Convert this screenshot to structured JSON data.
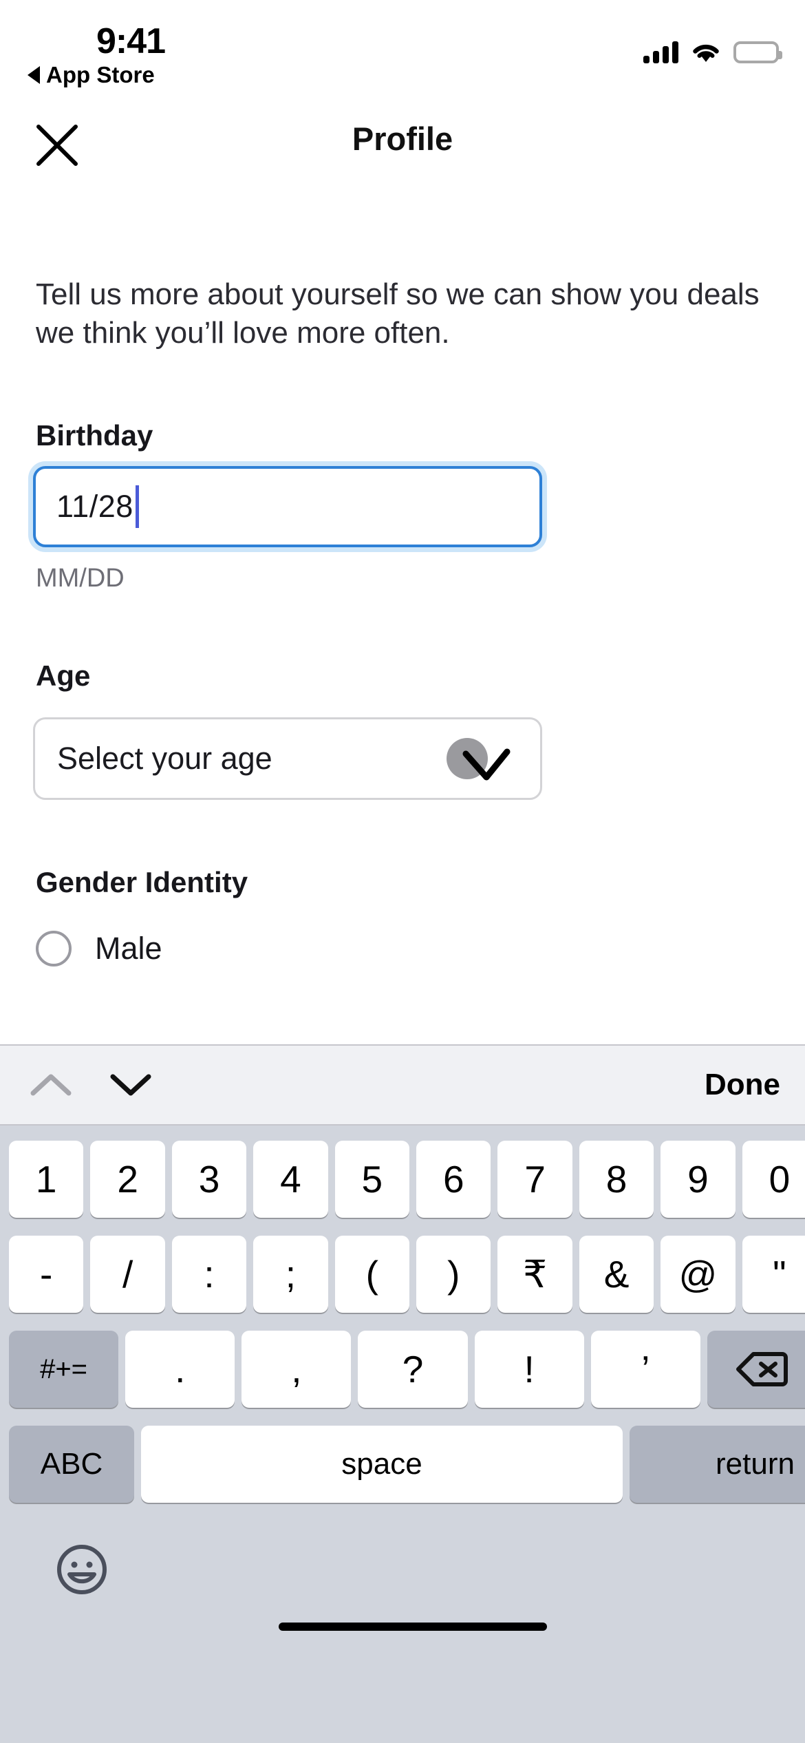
{
  "status_bar": {
    "time": "9:41",
    "back_label": "App Store",
    "back_icon": "triangle-left-icon",
    "signal_icon": "cellular-signal-icon",
    "signal_bars": 4,
    "wifi_icon": "wifi-icon",
    "battery_icon": "battery-full-icon"
  },
  "nav": {
    "close_icon": "close-x-icon",
    "title": "Profile"
  },
  "main": {
    "intro": "Tell us more about yourself so we can show you deals\nwe think you’ll love more often.",
    "birthday": {
      "label": "Birthday",
      "value": "11/28",
      "hint": "MM/DD",
      "focused": true,
      "focus_color": "#2e80d6",
      "caret_color": "#4b5bd8"
    },
    "age": {
      "label": "Age",
      "placeholder": "Select your age",
      "chevron_icon": "chevron-down-icon",
      "badge_color": "#9a9a9e"
    },
    "gender": {
      "label": "Gender Identity",
      "options": [
        {
          "label": "Male",
          "selected": false
        }
      ]
    }
  },
  "keyboard": {
    "toolbar": {
      "prev_icon": "chevron-up-icon",
      "prev_enabled": false,
      "next_icon": "chevron-down-icon",
      "next_enabled": true,
      "done_label": "Done"
    },
    "rows": [
      [
        "1",
        "2",
        "3",
        "4",
        "5",
        "6",
        "7",
        "8",
        "9",
        "0"
      ],
      [
        "-",
        "/",
        ":",
        ";",
        "(",
        ")",
        "₹",
        "&",
        "@",
        "\""
      ],
      [
        "#+=",
        ".",
        ",",
        "?",
        "!",
        "’",
        "delete-icon"
      ],
      [
        "ABC",
        "space",
        "return"
      ]
    ],
    "symbols_key_label": "#+=",
    "delete_icon": "delete-backspace-icon",
    "abc_label": "ABC",
    "space_label": "space",
    "return_label": "return",
    "emoji_icon": "emoji-smiley-icon",
    "background_color": "#d1d5dd",
    "key_color": "#ffffff",
    "fn_key_color": "#aeb3bf"
  }
}
